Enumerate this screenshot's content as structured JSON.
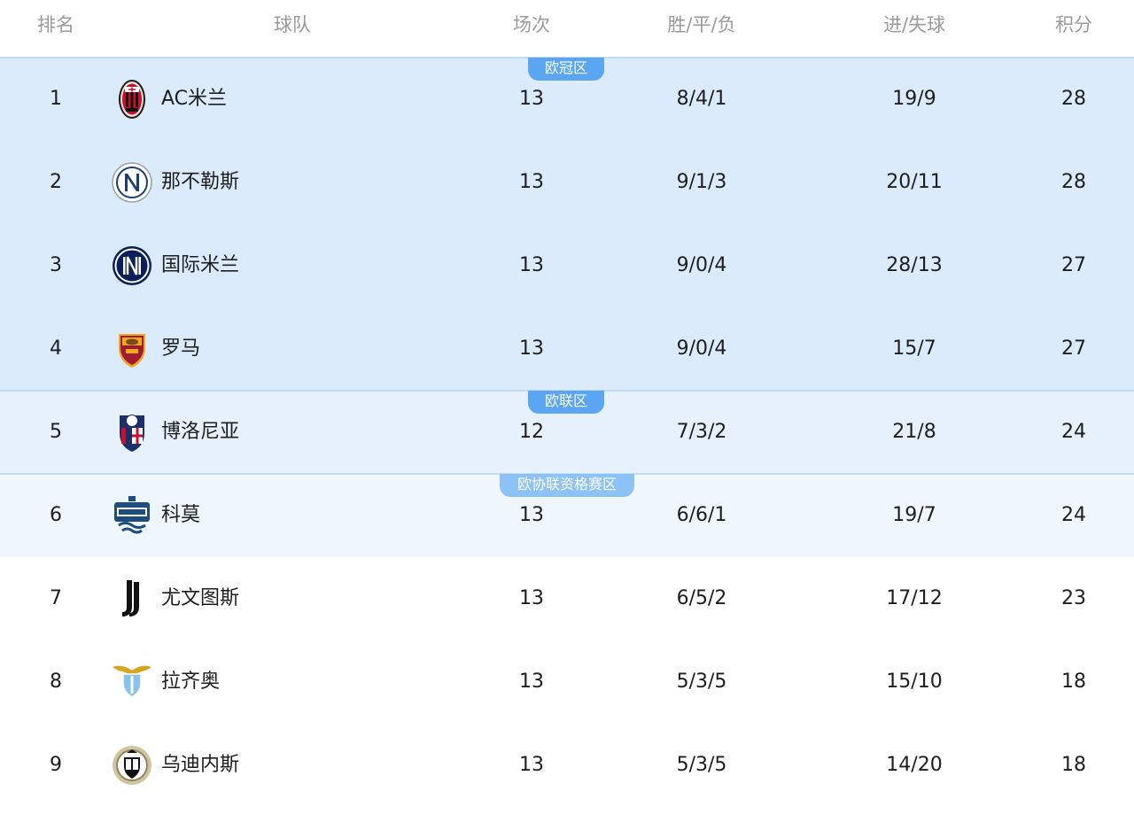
{
  "header": {
    "rank": "排名",
    "team": "球队",
    "played": "场次",
    "wdl": "胜/平/负",
    "goals": "进/失球",
    "points": "积分"
  },
  "zones": {
    "ucl": "欧冠区",
    "uel": "欧联区",
    "uecl": "欧协联资格赛区"
  },
  "colors": {
    "zone_ucl_bg": "#dcebfc",
    "zone_uel_bg": "#e6f1fd",
    "zone_uecl_bg": "#eff6fe",
    "badge": "#5aa6f2",
    "header_text": "#9a9a9a"
  },
  "rows": [
    {
      "rank": "1",
      "team": "AC米兰",
      "logo": "ac-milan-crest-icon",
      "played": "13",
      "wdl": "8/4/1",
      "goals": "19/9",
      "points": "28"
    },
    {
      "rank": "2",
      "team": "那不勒斯",
      "logo": "napoli-crest-icon",
      "played": "13",
      "wdl": "9/1/3",
      "goals": "20/11",
      "points": "28"
    },
    {
      "rank": "3",
      "team": "国际米兰",
      "logo": "inter-crest-icon",
      "played": "13",
      "wdl": "9/0/4",
      "goals": "28/13",
      "points": "27"
    },
    {
      "rank": "4",
      "team": "罗马",
      "logo": "roma-crest-icon",
      "played": "13",
      "wdl": "9/0/4",
      "goals": "15/7",
      "points": "27"
    },
    {
      "rank": "5",
      "team": "博洛尼亚",
      "logo": "bologna-crest-icon",
      "played": "12",
      "wdl": "7/3/2",
      "goals": "21/8",
      "points": "24"
    },
    {
      "rank": "6",
      "team": "科莫",
      "logo": "como-crest-icon",
      "played": "13",
      "wdl": "6/6/1",
      "goals": "19/7",
      "points": "24"
    },
    {
      "rank": "7",
      "team": "尤文图斯",
      "logo": "juventus-crest-icon",
      "played": "13",
      "wdl": "6/5/2",
      "goals": "17/12",
      "points": "23"
    },
    {
      "rank": "8",
      "team": "拉齐奥",
      "logo": "lazio-crest-icon",
      "played": "13",
      "wdl": "5/3/5",
      "goals": "15/10",
      "points": "18"
    },
    {
      "rank": "9",
      "team": "乌迪内斯",
      "logo": "udinese-crest-icon",
      "played": "13",
      "wdl": "5/3/5",
      "goals": "14/20",
      "points": "18"
    }
  ]
}
